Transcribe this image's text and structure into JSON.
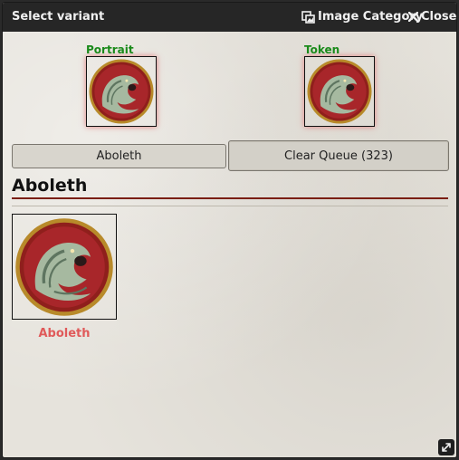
{
  "window": {
    "title": "Select variant",
    "image_category_label": "Image Category",
    "close_label": "Close"
  },
  "slots": {
    "portrait_label": "Portrait",
    "token_label": "Token"
  },
  "buttons": {
    "aboleth_label": "Aboleth",
    "clear_queue_label": "Clear Queue (323)"
  },
  "section": {
    "title": "Aboleth"
  },
  "variants": [
    {
      "label": "Aboleth",
      "icon": "aboleth-token-icon"
    }
  ],
  "colors": {
    "slot_label": "#1a8a1a",
    "variant_label": "#e05a5a",
    "section_rule": "#7a1e12",
    "titlebar": "#262626"
  }
}
